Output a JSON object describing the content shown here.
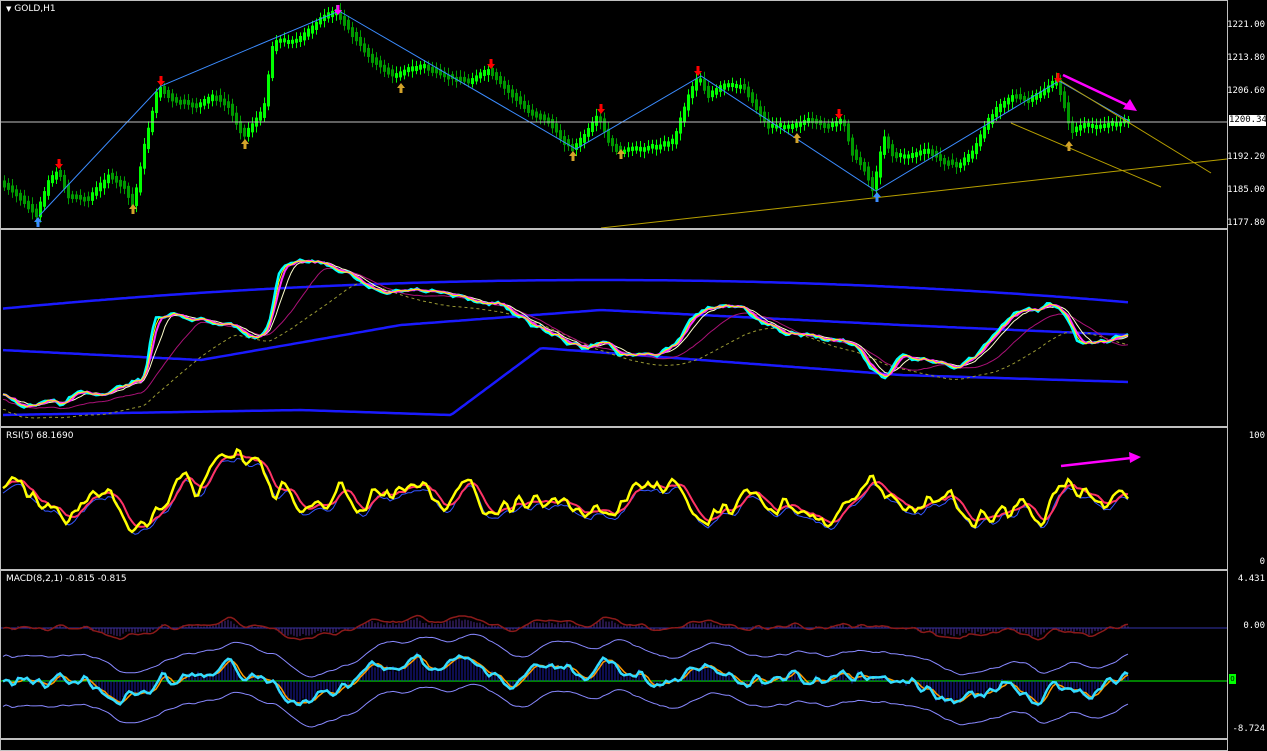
{
  "main": {
    "symbol": "GOLD,H1",
    "current_price": "1200.34",
    "y_ticks": [
      "1221.00",
      "1213.80",
      "1206.60",
      "1192.20",
      "1185.00",
      "1177.80"
    ],
    "colors": {
      "bull": "#00ff00",
      "bear": "#ff0000",
      "zigzag": "#3b8cff",
      "up_arrow": "#d4a32a",
      "down_arrow": "#ff0000",
      "magenta": "#ff00ff"
    }
  },
  "pane2": {
    "label": ""
  },
  "rsi": {
    "label": "RSI(5) 68.1690",
    "y_ticks": [
      "100",
      "0"
    ]
  },
  "macd": {
    "label": "MACD(8,2,1) -0.815 -0.815",
    "y_ticks": [
      "4.431",
      "0.00",
      "-8.724"
    ],
    "level_box": "0"
  }
}
